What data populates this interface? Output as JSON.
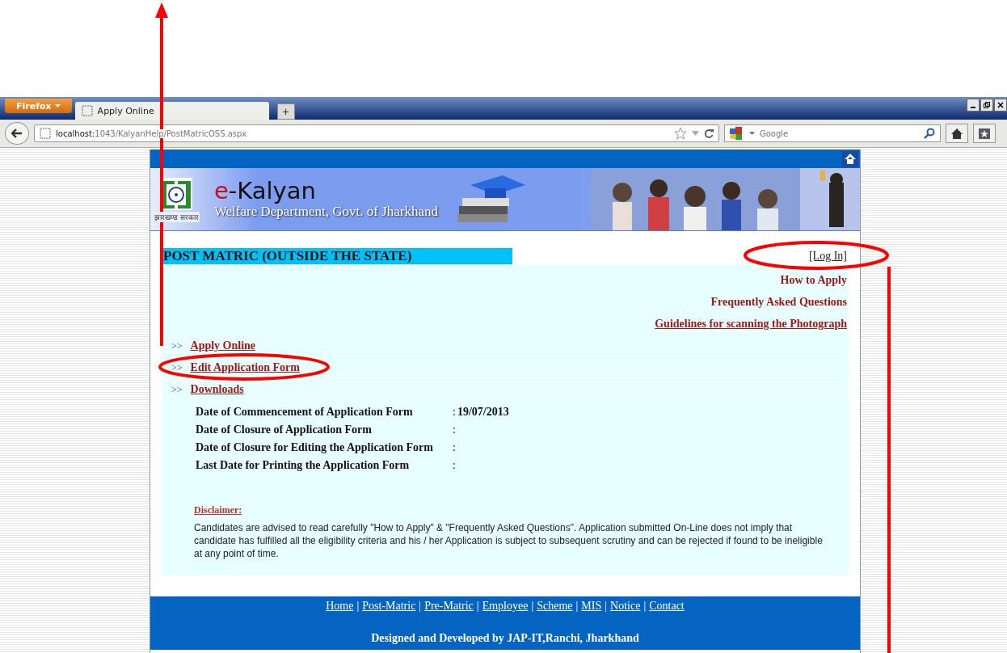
{
  "browser": {
    "menu_button": "Firefox",
    "tabs": [
      {
        "title": "Apply Online",
        "selected": true
      }
    ],
    "new_tab": "+",
    "url_host": "localhost:",
    "url_path": "1043/KalyanHelp/PostMatricOSS.aspx",
    "search_placeholder": "Google"
  },
  "header": {
    "title": "e-Kalyan",
    "subtitle": "Welfare Department, Govt. of Jharkhand",
    "logo_caption": "झारखण्ड सरकार"
  },
  "section": {
    "title": "POST MATRIC (OUTSIDE THE STATE)",
    "login": "[Log In]"
  },
  "help_links": [
    "How to Apply",
    "Frequently Asked Questions",
    "Guidelines for scanning the Photograph"
  ],
  "menu": [
    {
      "bullet": ">>",
      "label": "Apply Online"
    },
    {
      "bullet": ">>",
      "label": "Edit Application Form"
    },
    {
      "bullet": ">>",
      "label": "Downloads"
    }
  ],
  "dates": [
    {
      "label": "Date of Commencement of Application Form",
      "separator": ":",
      "value": "19/07/2013"
    },
    {
      "label": "Date of Closure of Application Form",
      "separator": ":"
    },
    {
      "label": "Date of Closure for Editing the Application Form",
      "separator": ":"
    },
    {
      "label": "Last Date for Printing the Application Form",
      "separator": ":"
    }
  ],
  "disclaimer": {
    "heading": "Disclaimer:",
    "text": "Candidates are advised to read carefully \"How to Apply\" & \"Frequently Asked Questions\". Application submitted On-Line does not imply that candidate has fulfilled all the eligibility criteria and his / her Application is subject to subsequent scrutiny and can be rejected if found to be ineligible at any point of time."
  },
  "footer": {
    "links": [
      "Home",
      "Post-Matric",
      "Pre-Matric",
      "Employee",
      "Scheme",
      "MIS",
      "Notice",
      "Contact"
    ],
    "divider": "|",
    "credit": "Designed and Developed by JAP-IT,Ranchi, Jharkhand"
  },
  "annotations": [
    {
      "kind": "arrow"
    },
    {
      "kind": "ellipse"
    },
    {
      "kind": "ellipse"
    },
    {
      "kind": "line"
    }
  ]
}
